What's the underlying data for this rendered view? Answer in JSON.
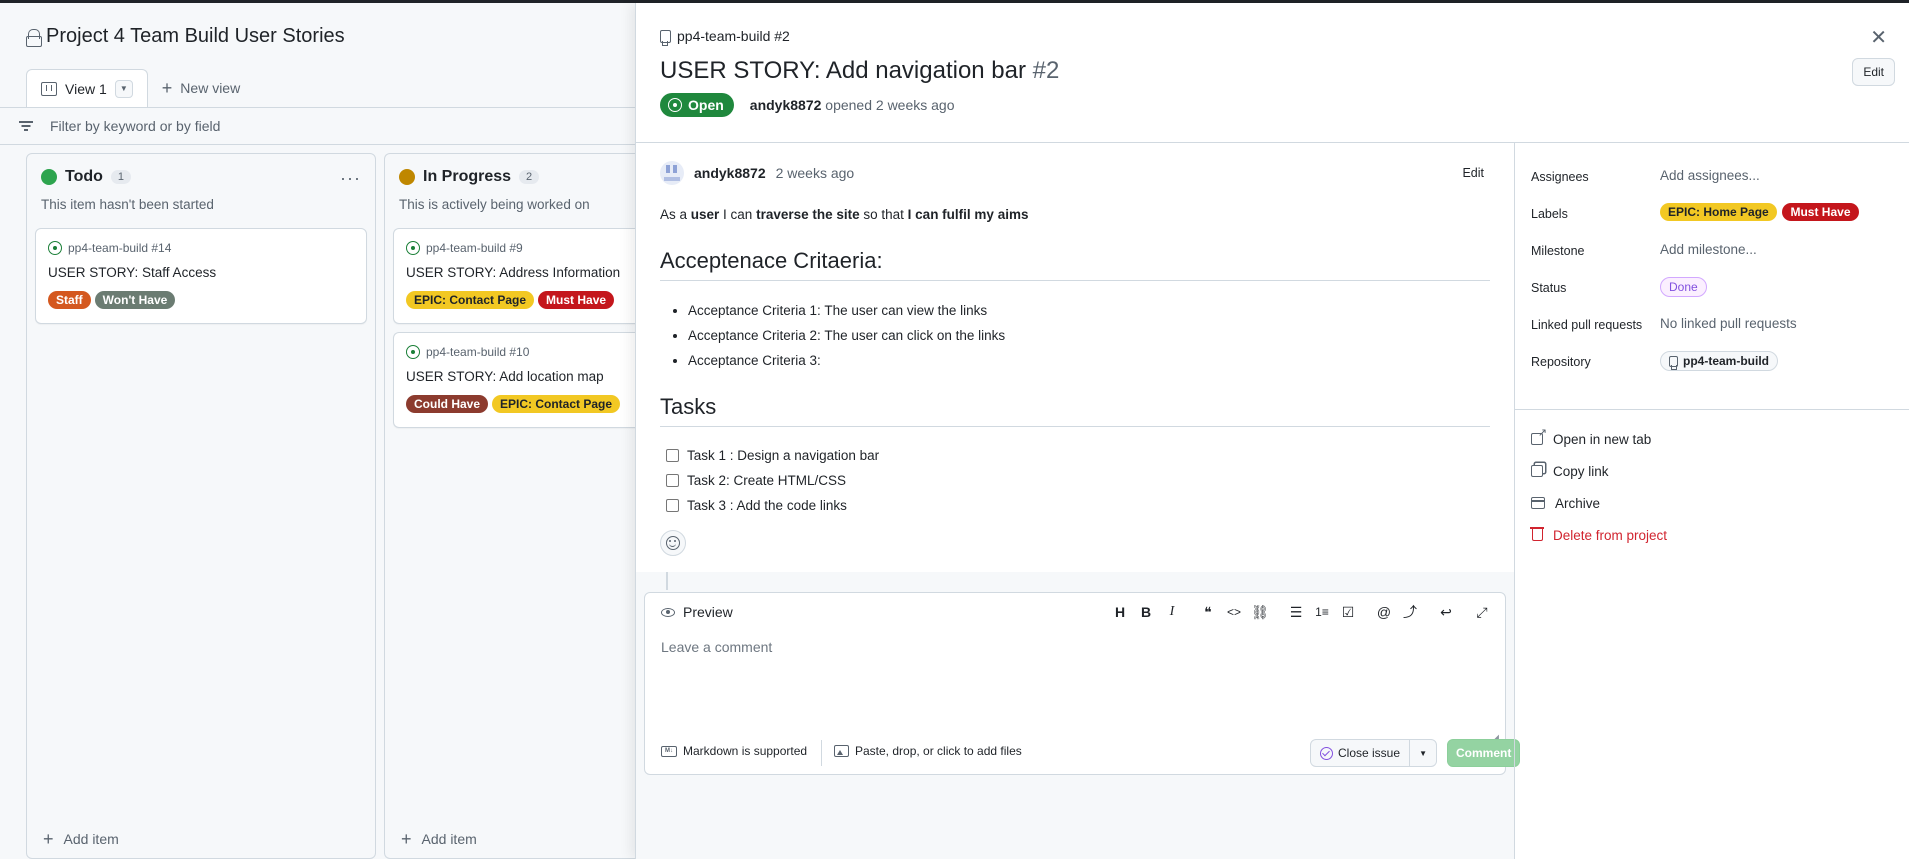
{
  "project": {
    "title": "Project 4 Team Build User Stories",
    "view_tab": "View 1",
    "new_view": "New view",
    "filter_placeholder": "Filter by keyword or by field"
  },
  "columns": [
    {
      "name": "Todo",
      "count": "1",
      "description": "This item hasn't been started",
      "color": "#2da44e",
      "add_item": "Add item",
      "cards": [
        {
          "ref": "pp4-team-build #14",
          "title": "USER STORY: Staff Access",
          "labels": [
            {
              "text": "Staff",
              "bg": "#d4581f",
              "fg": "#ffffff"
            },
            {
              "text": "Won't Have",
              "bg": "#6b7c72",
              "fg": "#ffffff"
            }
          ]
        }
      ]
    },
    {
      "name": "In Progress",
      "count": "2",
      "description": "This is actively being worked on",
      "color": "#bf8700",
      "add_item": "Add item",
      "cards": [
        {
          "ref": "pp4-team-build #9",
          "title": "USER STORY: Address Information",
          "labels": [
            {
              "text": "EPIC: Contact Page",
              "bg": "#f2c823",
              "fg": "#1f2328"
            },
            {
              "text": "Must Have",
              "bg": "#c4161c",
              "fg": "#ffffff"
            }
          ]
        },
        {
          "ref": "pp4-team-build #10",
          "title": "USER STORY: Add location map",
          "labels": [
            {
              "text": "Could Have",
              "bg": "#8c3b2e",
              "fg": "#ffffff"
            },
            {
              "text": "EPIC: Contact Page",
              "bg": "#f2c823",
              "fg": "#1f2328"
            }
          ]
        }
      ]
    }
  ],
  "issue": {
    "repo_ref": "pp4-team-build #2",
    "title": "USER STORY: Add navigation bar",
    "number": "#2",
    "edit": "Edit",
    "state": "Open",
    "author": "andyk8872",
    "opened_text": "opened 2 weeks ago",
    "comment": {
      "author": "andyk8872",
      "time": "2 weeks ago",
      "edit": "Edit",
      "body_parts": [
        "As a ",
        "user",
        " I can ",
        "traverse the site",
        " so that ",
        "I can fulfil my aims"
      ],
      "ac_heading": "Acceptenace Critaeria:",
      "ac_items": [
        "Acceptance Criteria 1: The user can view the links",
        "Acceptance Criteria 2: The user can click on the links",
        "Acceptance Criteria 3:"
      ],
      "tasks_heading": "Tasks",
      "tasks": [
        "Task 1 : Design a navigation bar",
        "Task 2: Create HTML/CSS",
        "Task 3 : Add the code links"
      ]
    },
    "editor": {
      "tab": "Preview",
      "placeholder": "Leave a comment",
      "markdown_note": "Markdown is supported",
      "files_note": "Paste, drop, or click to add files",
      "close_issue": "Close issue",
      "comment_button": "Comment",
      "toolbar": [
        "H",
        "B",
        "I",
        "quote",
        "code",
        "link",
        "ul",
        "ol",
        "tasklist",
        "@",
        "crossref",
        "reply",
        "fullscreen"
      ]
    },
    "sidebar": {
      "assignees_label": "Assignees",
      "assignees_value": "Add assignees...",
      "labels_label": "Labels",
      "labels": [
        {
          "text": "EPIC: Home Page",
          "bg": "#f2c823",
          "fg": "#1f2328"
        },
        {
          "text": "Must Have",
          "bg": "#c4161c",
          "fg": "#ffffff"
        }
      ],
      "milestone_label": "Milestone",
      "milestone_value": "Add milestone...",
      "status_label": "Status",
      "status_value": "Done",
      "linked_label": "Linked pull requests",
      "linked_value": "No linked pull requests",
      "repo_label": "Repository",
      "repo_value": "pp4-team-build",
      "actions": [
        "Open in new tab",
        "Copy link",
        "Archive",
        "Delete from project"
      ]
    }
  }
}
